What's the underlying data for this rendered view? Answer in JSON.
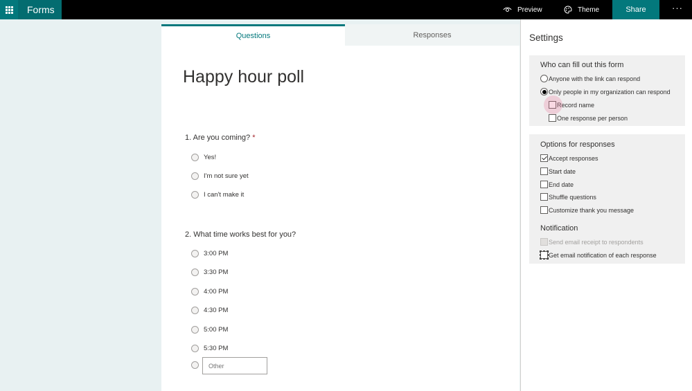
{
  "app": {
    "name": "Forms"
  },
  "topbar": {
    "preview_label": "Preview",
    "theme_label": "Theme",
    "share_label": "Share",
    "more_label": "···"
  },
  "tabs": {
    "questions": "Questions",
    "responses": "Responses"
  },
  "form": {
    "title": "Happy hour poll",
    "questions": [
      {
        "title": "1. Are you coming?",
        "required_mark": "*",
        "options": [
          "Yes!",
          "I'm not sure yet",
          "I can't make it"
        ]
      },
      {
        "title": "2. What time works best for you?",
        "options": [
          "3:00 PM",
          "3:30 PM",
          "4:00 PM",
          "4:30 PM",
          "5:00 PM",
          "5:30 PM"
        ],
        "other_placeholder": "Other"
      }
    ]
  },
  "settings": {
    "title": "Settings",
    "who": {
      "heading": "Who can fill out this form",
      "anyone": {
        "label": "Anyone with the link can respond",
        "selected": false
      },
      "org_only": {
        "label": "Only people in my organization can respond",
        "selected": true
      },
      "record_name": {
        "label": "Record name",
        "checked": false
      },
      "one_response": {
        "label": "One response per person",
        "checked": false
      }
    },
    "options": {
      "heading": "Options for responses",
      "accept": {
        "label": "Accept responses",
        "checked": true
      },
      "start_date": {
        "label": "Start date",
        "checked": false
      },
      "end_date": {
        "label": "End date",
        "checked": false
      },
      "shuffle": {
        "label": "Shuffle questions",
        "checked": false
      },
      "thank_you": {
        "label": "Customize thank you message",
        "checked": false
      }
    },
    "notification": {
      "heading": "Notification",
      "email_receipt": {
        "label": "Send email receipt to respondents",
        "checked": false,
        "disabled": true
      },
      "email_notification": {
        "label": "Get email notification of each response",
        "checked": false
      }
    }
  },
  "colors": {
    "brand": "#03787c",
    "app_tile": "#036c70",
    "topbar": "#000000",
    "canvas": "#e8f1f2",
    "required": "#a4262c"
  }
}
